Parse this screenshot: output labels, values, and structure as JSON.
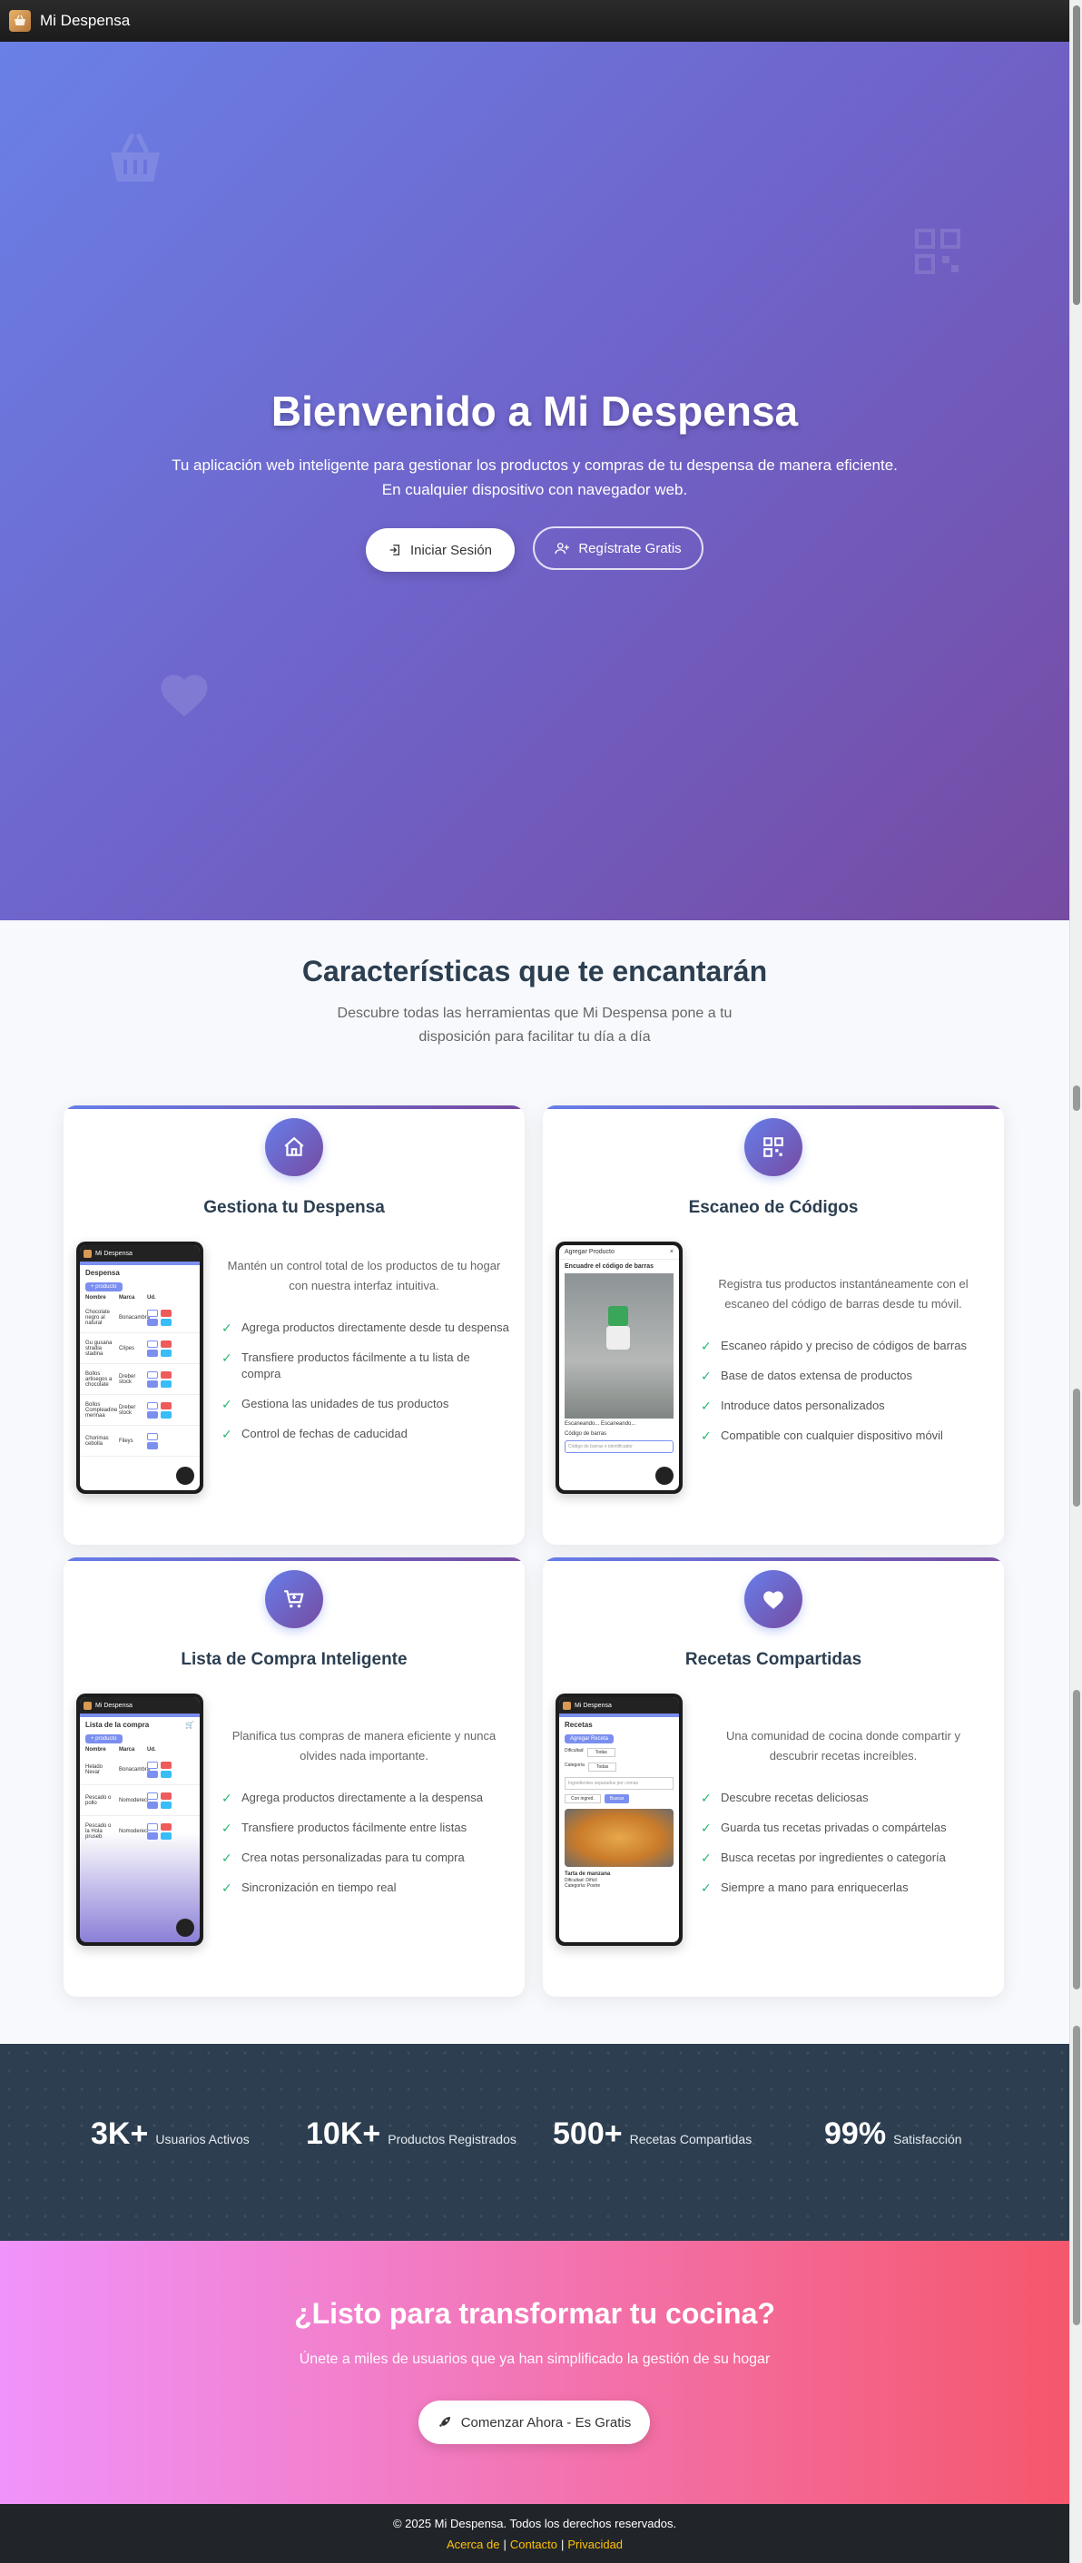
{
  "nav": {
    "brand": "Mi Despensa"
  },
  "hero": {
    "title_prefix": "Bienvenido a ",
    "title_brand": "Mi Despensa",
    "subtitle_line1": "Tu aplicación web inteligente para gestionar los productos y compras de tu despensa de manera eficiente.",
    "subtitle_line2": "En cualquier dispositivo con navegador web.",
    "login_label": "Iniciar Sesión",
    "register_label": "Regístrate Gratis"
  },
  "features": {
    "title": "Características que te encantarán",
    "subtitle": "Descubre todas las herramientas que Mi Despensa pone a tu disposición para facilitar tu día a día",
    "cards": [
      {
        "title": "Gestiona tu Despensa",
        "icon": "house-icon",
        "description": "Mantén un control total de los productos de tu hogar con nuestra interfaz intuitiva.",
        "items": [
          "Agrega productos directamente desde tu despensa",
          "Transfiere productos fácilmente a tu lista de compra",
          "Gestiona las unidades de tus productos",
          "Control de fechas de caducidad"
        ],
        "mock": {
          "brand": "Mi Despensa",
          "title": "Despensa",
          "button": "+ producto",
          "headers": [
            "Nombre",
            "Marca",
            "Ud."
          ],
          "rows": [
            [
              "Chocolate negro al natural",
              "Bonacambra",
              "1"
            ],
            [
              "Gu gusana stradia stadina",
              "Clípes",
              "1"
            ],
            [
              "Bollos artisegos a chocolate",
              "Dreber stock",
              "1"
            ],
            [
              "Bollos Compleadine merinaa",
              "Dreber stock",
              "1"
            ],
            [
              "Chorimas cebolla",
              "Fileys",
              "1"
            ]
          ]
        }
      },
      {
        "title": "Escaneo de Códigos",
        "icon": "qr-code-icon",
        "description": "Registra tus productos instantáneamente con el escaneo del código de barras desde tu móvil.",
        "items": [
          "Escaneo rápido y preciso de códigos de barras",
          "Base de datos extensa de productos",
          "Introduce datos personalizados",
          "Compatible con cualquier dispositivo móvil"
        ],
        "mock": {
          "title": "Agregar Producto",
          "scan_label": "Encuadre el código de barras",
          "status": "Escaneando... Escaneando...",
          "field_label": "Código de barras",
          "placeholder": "Código de barras o identificador"
        }
      },
      {
        "title": "Lista de Compra Inteligente",
        "icon": "cart-icon",
        "description": "Planifica tus compras de manera eficiente y nunca olvides nada importante.",
        "items": [
          "Agrega productos directamente a la despensa",
          "Transfiere productos fácilmente entre listas",
          "Crea notas personalizadas para tu compra",
          "Sincronización en tiempo real"
        ],
        "mock": {
          "brand": "Mi Despensa",
          "title": "Lista de la compra",
          "button": "+ producto",
          "headers": [
            "Nombre",
            "Marca",
            "Ud."
          ],
          "rows": [
            [
              "Helado Nevar",
              "Bonacambra",
              "1"
            ],
            [
              "Pescado o pollo",
              "Nomodereci",
              "1"
            ],
            [
              "Pescado o la Hola pruseb",
              "Nomodereci",
              "1"
            ]
          ]
        }
      },
      {
        "title": "Recetas Compartidas",
        "icon": "heart-icon",
        "description": "Una comunidad de cocina donde compartir y descubrir recetas increíbles.",
        "items": [
          "Descubre recetas deliciosas",
          "Guarda tus recetas privadas o compártelas",
          "Busca recetas por ingredientes o categoría",
          "Siempre a mano para enriquecerlas"
        ],
        "mock": {
          "brand": "Mi Despensa",
          "title": "Recetas",
          "button": "Agregar Receta",
          "f1_label": "Dificultad",
          "f1_value": "Todas",
          "f2_label": "Categoría",
          "f2_value": "Todas",
          "search_placeholder": "Ingredientes separados por comas",
          "sort_value": "Con ingred.",
          "search_btn": "Buscar",
          "recipe_name": "Tarta de manzana",
          "recipe_diff": "Dificultad: Difícil",
          "recipe_cat": "Categoría: Postre"
        }
      }
    ]
  },
  "stats": [
    {
      "value": "3K+",
      "label": "Usuarios Activos"
    },
    {
      "value": "10K+",
      "label": "Productos Registrados"
    },
    {
      "value": "500+",
      "label": "Recetas Compartidas"
    },
    {
      "value": "99%",
      "label": "Satisfacción"
    }
  ],
  "cta": {
    "title": "¿Listo para transformar tu cocina?",
    "subtitle": "Únete a miles de usuarios que ya han simplificado la gestión de su hogar",
    "button": "Comenzar Ahora - Es Gratis"
  },
  "footer": {
    "copyright": "© 2025 Mi Despensa. Todos los derechos reservados.",
    "links": [
      "Acerca de",
      "Contacto",
      "Privacidad"
    ],
    "separator": "|"
  },
  "colors": {
    "hero_start": "#667eea",
    "hero_end": "#764ba2",
    "stats_bg": "#2c3e50",
    "cta_start": "#f093fb",
    "cta_end": "#f5576c",
    "footer_link": "#ffc107",
    "check": "#2bb673"
  }
}
